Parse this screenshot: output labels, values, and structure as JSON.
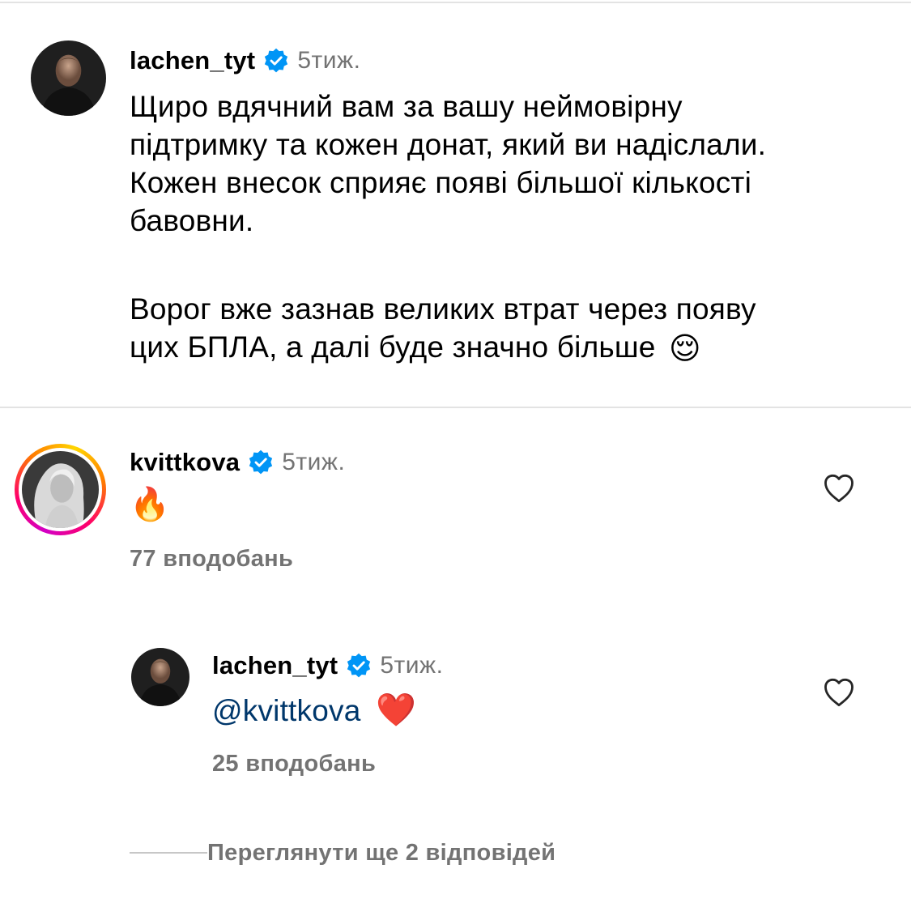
{
  "comment_main": {
    "username": "lachen_tyt",
    "time": "5тиж.",
    "lines": [
      "Щиро вдячний вам за вашу неймовірну",
      "підтримку та кожен донат, який ви надіслали.",
      "Кожен внесок сприяє появі більшої кількості",
      "бавовни.",
      "",
      "Ворог вже зазнав великих втрат через появу",
      "цих БПЛА, а далі буде значно більше"
    ],
    "emoji": "😌"
  },
  "comment_second": {
    "username": "kvittkova",
    "time": "5тиж.",
    "emoji": "🔥",
    "likes": "77 вподобань"
  },
  "reply": {
    "username": "lachen_tyt",
    "time": "5тиж.",
    "mention": "@kvittkova",
    "emoji": "❤️",
    "likes": "25 вподобань"
  },
  "view_replies": "Переглянути ще 2 відповідей",
  "icons": {
    "verified": "verified-badge-icon",
    "heart": "heart-outline-icon"
  },
  "colors": {
    "verified_blue": "#0095f6",
    "secondary_text": "#737373",
    "mention": "#00376b"
  }
}
